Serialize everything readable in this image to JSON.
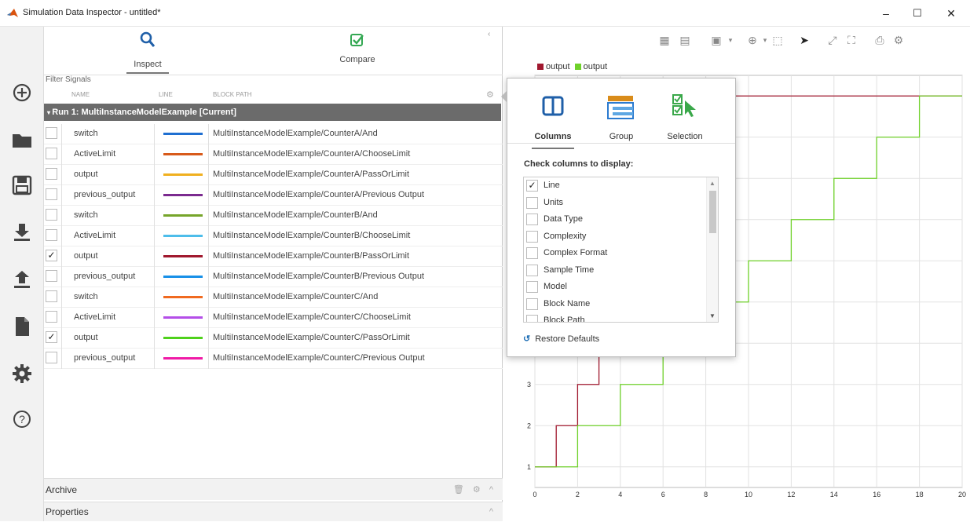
{
  "window": {
    "title": "Simulation Data Inspector - untitled*",
    "minimize": "–",
    "maximize": "☐",
    "close": "✕"
  },
  "tabs": {
    "inspect": "Inspect",
    "compare": "Compare"
  },
  "filter_label": "Filter Signals",
  "columns": {
    "name": "NAME",
    "line": "LINE",
    "block_path": "BLOCK PATH"
  },
  "run_label": "Run 1: MultiInstanceModelExample [Current]",
  "signals": [
    {
      "checked": "",
      "name": "switch",
      "color": "#1f6fd1",
      "path": "MultiInstanceModelExample/CounterA/And"
    },
    {
      "checked": "",
      "name": "ActiveLimit",
      "color": "#d85a1a",
      "path": "MultiInstanceModelExample/CounterA/ChooseLimit"
    },
    {
      "checked": "",
      "name": "output",
      "color": "#f0b020",
      "path": "MultiInstanceModelExample/CounterA/PassOrLimit"
    },
    {
      "checked": "",
      "name": "previous_output",
      "color": "#7b2a8f",
      "path": "MultiInstanceModelExample/CounterA/Previous Output"
    },
    {
      "checked": "",
      "name": "switch",
      "color": "#76a52a",
      "path": "MultiInstanceModelExample/CounterB/And"
    },
    {
      "checked": "",
      "name": "ActiveLimit",
      "color": "#4dbdea",
      "path": "MultiInstanceModelExample/CounterB/ChooseLimit"
    },
    {
      "checked": "✓",
      "name": "output",
      "color": "#a0182e",
      "path": "MultiInstanceModelExample/CounterB/PassOrLimit"
    },
    {
      "checked": "",
      "name": "previous_output",
      "color": "#1890e8",
      "path": "MultiInstanceModelExample/CounterB/Previous Output"
    },
    {
      "checked": "",
      "name": "switch",
      "color": "#f06a20",
      "path": "MultiInstanceModelExample/CounterC/And"
    },
    {
      "checked": "",
      "name": "ActiveLimit",
      "color": "#b44ee8",
      "path": "MultiInstanceModelExample/CounterC/ChooseLimit"
    },
    {
      "checked": "✓",
      "name": "output",
      "color": "#4fd11c",
      "path": "MultiInstanceModelExample/CounterC/PassOrLimit"
    },
    {
      "checked": "",
      "name": "previous_output",
      "color": "#f01aa6",
      "path": "MultiInstanceModelExample/CounterC/Previous Output"
    }
  ],
  "archive_label": "Archive",
  "properties_label": "Properties",
  "legend": [
    {
      "label": "output",
      "color": "#a0182e"
    },
    {
      "label": "output",
      "color": "#6fd12a"
    }
  ],
  "popover": {
    "tabs": {
      "columns": "Columns",
      "group": "Group",
      "selection": "Selection"
    },
    "heading": "Check columns to display:",
    "items": [
      {
        "checked": "✓",
        "label": "Line"
      },
      {
        "checked": "",
        "label": "Units"
      },
      {
        "checked": "",
        "label": "Data Type"
      },
      {
        "checked": "",
        "label": "Complexity"
      },
      {
        "checked": "",
        "label": "Complex Format"
      },
      {
        "checked": "",
        "label": "Sample Time"
      },
      {
        "checked": "",
        "label": "Model"
      },
      {
        "checked": "",
        "label": "Block Name"
      },
      {
        "checked": "",
        "label": "Block Path"
      }
    ],
    "restore": "Restore Defaults"
  },
  "chart_data": {
    "type": "line",
    "step": true,
    "xlim": [
      0,
      20
    ],
    "ylim": [
      0.5,
      10.5
    ],
    "x_ticks": [
      0,
      2,
      4,
      6,
      8,
      10,
      12,
      14,
      16,
      18,
      20
    ],
    "y_ticks": [
      1,
      2,
      3
    ],
    "grid": true,
    "legend_placement": "top-left",
    "series": [
      {
        "name": "output",
        "color": "#a0182e",
        "x": [
          0,
          1,
          2,
          3,
          4,
          5,
          20
        ],
        "y": [
          1,
          2,
          3,
          4,
          5,
          10,
          10
        ]
      },
      {
        "name": "output",
        "color": "#6fd12a",
        "x": [
          0,
          2,
          4,
          6,
          8,
          10,
          12,
          14,
          16,
          18,
          20
        ],
        "y": [
          1,
          2,
          3,
          4,
          5,
          6,
          7,
          8,
          9,
          10,
          10
        ]
      }
    ]
  }
}
